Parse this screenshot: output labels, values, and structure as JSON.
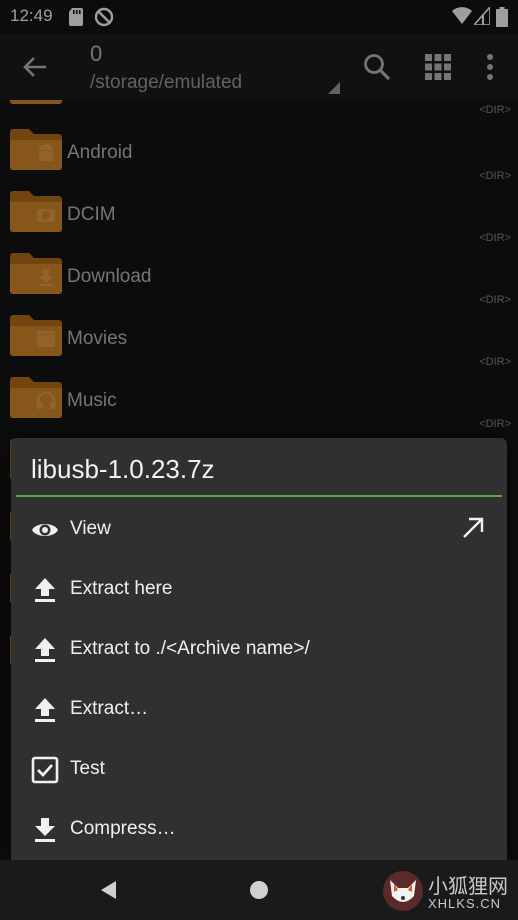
{
  "status_bar": {
    "time": "12:49",
    "icons": [
      "sd-card-icon",
      "no-disturb-icon",
      "wifi-icon",
      "signal-icon",
      "battery-icon"
    ]
  },
  "toolbar": {
    "count": "0",
    "path": "/storage/emulated",
    "icons": [
      "back-arrow-icon",
      "search-icon",
      "grid-view-icon",
      "more-vert-icon"
    ]
  },
  "files": [
    {
      "name": "",
      "type": "<DIR>",
      "emblem": "none"
    },
    {
      "name": "Android",
      "type": "<DIR>",
      "emblem": "android"
    },
    {
      "name": "DCIM",
      "type": "<DIR>",
      "emblem": "camera"
    },
    {
      "name": "Download",
      "type": "<DIR>",
      "emblem": "download"
    },
    {
      "name": "Movies",
      "type": "<DIR>",
      "emblem": "movie"
    },
    {
      "name": "Music",
      "type": "<DIR>",
      "emblem": "headphones"
    }
  ],
  "dialog": {
    "title": "libusb-1.0.23.7z",
    "accent_color": "#57a83a",
    "items": [
      {
        "label": "View",
        "icon": "eye-icon",
        "extra_icon": "open-external-arrow-icon"
      },
      {
        "label": "Extract here",
        "icon": "extract-icon"
      },
      {
        "label": "Extract to ./<Archive name>/",
        "icon": "extract-icon"
      },
      {
        "label": "Extract…",
        "icon": "extract-icon"
      },
      {
        "label": "Test",
        "icon": "checkbox-icon"
      },
      {
        "label": "Compress…",
        "icon": "compress-icon"
      }
    ]
  },
  "nav": [
    "back-triangle-icon",
    "home-circle-icon"
  ],
  "watermark": {
    "chinese": "小狐狸网",
    "domain": "XHLKS.CN"
  },
  "colors": {
    "folder": "#d98b2b",
    "folder_dark": "#b86f1a",
    "background": "#141414",
    "dialog": "#303030"
  }
}
